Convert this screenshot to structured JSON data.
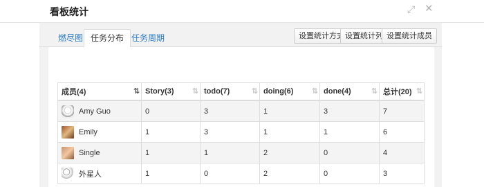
{
  "dialog": {
    "title": "看板统计"
  },
  "tabs": [
    {
      "label": "燃尽图",
      "active": false
    },
    {
      "label": "任务分布",
      "active": true
    },
    {
      "label": "任务周期",
      "active": false
    }
  ],
  "toolbar": {
    "method_label": "设置统计方式",
    "columns_label": "设置统计列",
    "members_label": "设置统计成员"
  },
  "table": {
    "headers": [
      "成员(4)",
      "Story(3)",
      "todo(7)",
      "doing(6)",
      "done(4)",
      "总计(20)"
    ],
    "rows": [
      {
        "name": "Amy Guo",
        "avatar": "avatar-sketch",
        "values": [
          "0",
          "3",
          "1",
          "3",
          "7"
        ]
      },
      {
        "name": "Emily",
        "avatar": "avatar-photo",
        "values": [
          "1",
          "3",
          "1",
          "1",
          "6"
        ]
      },
      {
        "name": "Single",
        "avatar": "avatar-photo",
        "values": [
          "1",
          "1",
          "2",
          "0",
          "4"
        ]
      },
      {
        "name": "外星人",
        "avatar": "avatar-sketch",
        "values": [
          "1",
          "0",
          "2",
          "0",
          "3"
        ]
      }
    ]
  },
  "icons": {
    "expand": "expand-icon",
    "close": "close-icon",
    "sort": "sort-icon"
  },
  "colors": {
    "tab_link": "#2a7bc7",
    "panel_bg": "#f2f2f2",
    "row_stripe": "#f4f4f4"
  }
}
